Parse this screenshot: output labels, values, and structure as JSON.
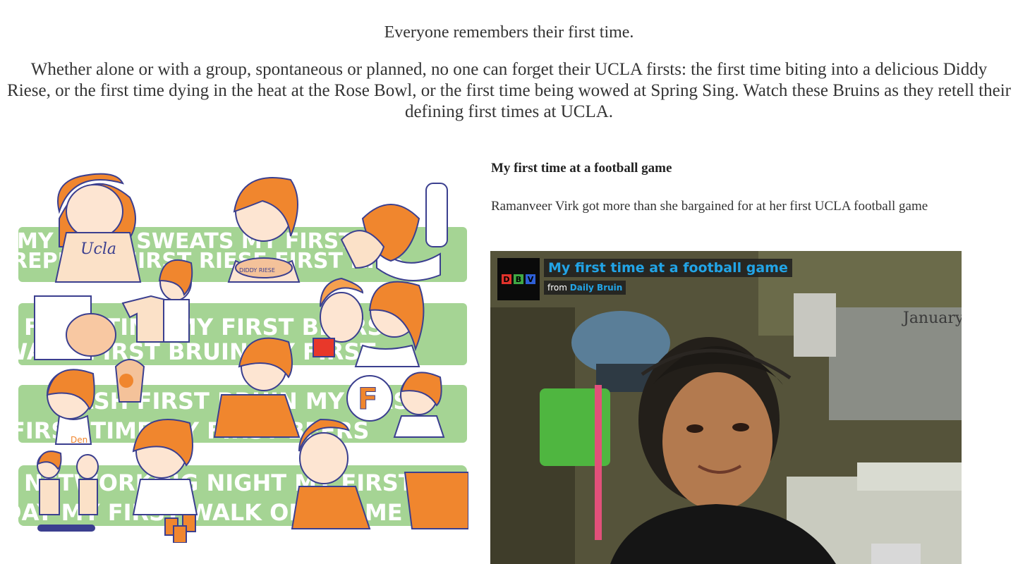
{
  "intro": {
    "heading": "Everyone remembers their first time.",
    "body": "Whether alone or with a group, spontaneous or planned, no one can forget their UCLA firsts: the first time biting into a delicious Diddy Riese, or the first time dying in the heat at the Rose Bowl, or the first time being wowed at Spring Sing. Watch these Bruins as they retell their defining first times at UCLA."
  },
  "comic": {
    "band_text": [
      "MY FIRST SWEATS MY FIRST",
      "CREPE MY FIRST RIESE FIRST KISS",
      "FIRST TIME MY FIRST BEERS",
      "WASH FIRST BRUIN MY FIRST",
      "NETWORKING NIGHT MY FIRST DATE",
      "DAY MY FIRST WALK OF SHAME"
    ],
    "labels": {
      "shirt": "Ucla",
      "bowl": "DIDDY RIESE",
      "den": "Den",
      "letter": "F"
    },
    "colors": {
      "band": "#9fd08f",
      "hair": "#f0862e",
      "ink": "#3b3f8f"
    }
  },
  "story": {
    "title": "My first time at a football game",
    "description": "Ramanveer Virk got more than she bargained for at her first UCLA football game"
  },
  "video": {
    "title": "My first time at a football game",
    "from_label": "from",
    "channel": "Daily Bruin",
    "logo_letters": [
      "D",
      "B",
      "V"
    ],
    "logo_colors": [
      "#e0322b",
      "#3fa845",
      "#2e5fd6"
    ],
    "calendar_text": "January",
    "accent": "#22a4e6"
  }
}
